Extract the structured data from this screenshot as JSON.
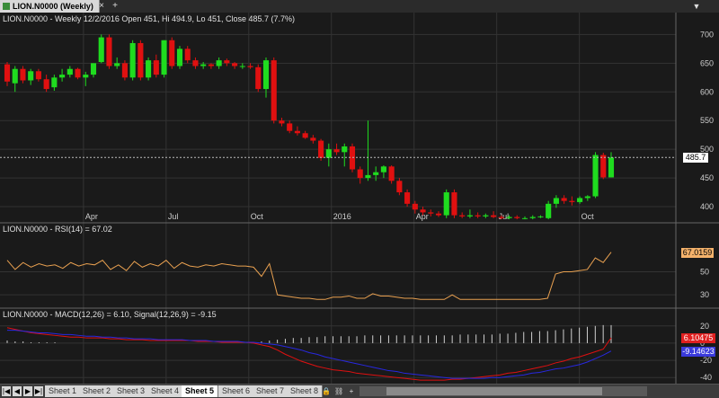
{
  "window": {
    "tab_title": "LION.N0000 (Weekly)",
    "close_glyph": "×",
    "add_glyph": "+",
    "dropdown_glyph": "▼",
    "icons": {
      "doc": "chart-doc-icon",
      "close": "close-icon",
      "add": "add-tab-icon",
      "dropdown": "chevron-down-icon"
    }
  },
  "sheets": {
    "nav": [
      "|◀",
      "◀",
      "▶",
      "▶|"
    ],
    "tabs": [
      "Sheet 1",
      "Sheet 2",
      "Sheet 3",
      "Sheet 4",
      "Sheet 5",
      "Sheet 6",
      "Sheet 7",
      "Sheet 8"
    ],
    "active": "Sheet 5",
    "icons": [
      "lock-icon",
      "link-icon",
      "add-icon"
    ]
  },
  "colors": {
    "bg": "#1a1a1a",
    "up": "#1fdc1f",
    "down": "#e01010",
    "rsi": "#e8a050",
    "macd": "#e01010",
    "signal": "#2828e0",
    "grid": "#333333",
    "last_price_line": "#bbbbbb",
    "price_box": "#ffffff",
    "rsi_box": "#f5b26b",
    "macd_box": "#e02020",
    "signal_box": "#3a3adc"
  },
  "chart_data": [
    {
      "type": "candlestick",
      "title": "LION.N0000 - Weekly 12/2/2016 Open 451, Hi 494.9, Lo 451, Close 485.7 (7.7%)",
      "x_tick_labels": [
        "Apr",
        "Jul",
        "Oct",
        "2016",
        "Apr",
        "Jul",
        "Oct"
      ],
      "y_ticks": [
        400,
        450,
        500,
        550,
        600,
        650,
        700
      ],
      "ylim": [
        375,
        710
      ],
      "last_value": 485.7,
      "last_label": "485.7",
      "candles": [
        {
          "o": 648,
          "h": 652,
          "l": 610,
          "c": 618
        },
        {
          "o": 615,
          "h": 645,
          "l": 600,
          "c": 640
        },
        {
          "o": 640,
          "h": 645,
          "l": 615,
          "c": 620
        },
        {
          "o": 620,
          "h": 640,
          "l": 612,
          "c": 636
        },
        {
          "o": 636,
          "h": 640,
          "l": 618,
          "c": 622
        },
        {
          "o": 622,
          "h": 630,
          "l": 600,
          "c": 605
        },
        {
          "o": 608,
          "h": 630,
          "l": 602,
          "c": 625
        },
        {
          "o": 625,
          "h": 640,
          "l": 618,
          "c": 630
        },
        {
          "o": 630,
          "h": 645,
          "l": 625,
          "c": 640
        },
        {
          "o": 640,
          "h": 642,
          "l": 622,
          "c": 625
        },
        {
          "o": 625,
          "h": 635,
          "l": 610,
          "c": 630
        },
        {
          "o": 630,
          "h": 650,
          "l": 625,
          "c": 650
        },
        {
          "o": 652,
          "h": 700,
          "l": 650,
          "c": 695
        },
        {
          "o": 695,
          "h": 700,
          "l": 640,
          "c": 645
        },
        {
          "o": 645,
          "h": 660,
          "l": 640,
          "c": 650
        },
        {
          "o": 650,
          "h": 655,
          "l": 620,
          "c": 625
        },
        {
          "o": 625,
          "h": 690,
          "l": 620,
          "c": 685
        },
        {
          "o": 685,
          "h": 690,
          "l": 620,
          "c": 625
        },
        {
          "o": 625,
          "h": 660,
          "l": 620,
          "c": 655
        },
        {
          "o": 655,
          "h": 665,
          "l": 625,
          "c": 630
        },
        {
          "o": 630,
          "h": 690,
          "l": 625,
          "c": 690
        },
        {
          "o": 690,
          "h": 695,
          "l": 640,
          "c": 645
        },
        {
          "o": 645,
          "h": 680,
          "l": 640,
          "c": 675
        },
        {
          "o": 675,
          "h": 680,
          "l": 650,
          "c": 655
        },
        {
          "o": 655,
          "h": 660,
          "l": 640,
          "c": 645
        },
        {
          "o": 645,
          "h": 652,
          "l": 640,
          "c": 648
        },
        {
          "o": 648,
          "h": 650,
          "l": 640,
          "c": 645
        },
        {
          "o": 645,
          "h": 660,
          "l": 640,
          "c": 655
        },
        {
          "o": 655,
          "h": 658,
          "l": 645,
          "c": 650
        },
        {
          "o": 650,
          "h": 652,
          "l": 640,
          "c": 645
        },
        {
          "o": 645,
          "h": 650,
          "l": 640,
          "c": 645
        },
        {
          "o": 645,
          "h": 650,
          "l": 640,
          "c": 643
        },
        {
          "o": 643,
          "h": 648,
          "l": 600,
          "c": 605
        },
        {
          "o": 605,
          "h": 660,
          "l": 590,
          "c": 655
        },
        {
          "o": 655,
          "h": 660,
          "l": 545,
          "c": 550
        },
        {
          "o": 550,
          "h": 555,
          "l": 540,
          "c": 545
        },
        {
          "o": 545,
          "h": 550,
          "l": 528,
          "c": 532
        },
        {
          "o": 532,
          "h": 540,
          "l": 524,
          "c": 528
        },
        {
          "o": 528,
          "h": 532,
          "l": 518,
          "c": 520
        },
        {
          "o": 520,
          "h": 525,
          "l": 510,
          "c": 515
        },
        {
          "o": 515,
          "h": 518,
          "l": 480,
          "c": 485
        },
        {
          "o": 485,
          "h": 510,
          "l": 470,
          "c": 500
        },
        {
          "o": 500,
          "h": 510,
          "l": 490,
          "c": 495
        },
        {
          "o": 495,
          "h": 510,
          "l": 470,
          "c": 505
        },
        {
          "o": 505,
          "h": 510,
          "l": 460,
          "c": 465
        },
        {
          "o": 465,
          "h": 470,
          "l": 440,
          "c": 450
        },
        {
          "o": 450,
          "h": 550,
          "l": 445,
          "c": 455
        },
        {
          "o": 455,
          "h": 470,
          "l": 445,
          "c": 460
        },
        {
          "o": 460,
          "h": 472,
          "l": 450,
          "c": 470
        },
        {
          "o": 470,
          "h": 472,
          "l": 440,
          "c": 445
        },
        {
          "o": 445,
          "h": 450,
          "l": 420,
          "c": 425
        },
        {
          "o": 425,
          "h": 430,
          "l": 400,
          "c": 405
        },
        {
          "o": 405,
          "h": 410,
          "l": 388,
          "c": 395
        },
        {
          "o": 395,
          "h": 400,
          "l": 385,
          "c": 390
        },
        {
          "o": 390,
          "h": 395,
          "l": 383,
          "c": 388
        },
        {
          "o": 388,
          "h": 392,
          "l": 382,
          "c": 385
        },
        {
          "o": 385,
          "h": 430,
          "l": 380,
          "c": 425
        },
        {
          "o": 425,
          "h": 430,
          "l": 380,
          "c": 385
        },
        {
          "o": 385,
          "h": 390,
          "l": 380,
          "c": 383
        },
        {
          "o": 383,
          "h": 395,
          "l": 380,
          "c": 385
        },
        {
          "o": 385,
          "h": 390,
          "l": 380,
          "c": 383
        },
        {
          "o": 383,
          "h": 388,
          "l": 380,
          "c": 385
        },
        {
          "o": 385,
          "h": 392,
          "l": 380,
          "c": 382
        },
        {
          "o": 382,
          "h": 385,
          "l": 378,
          "c": 380
        },
        {
          "o": 380,
          "h": 385,
          "l": 378,
          "c": 382
        },
        {
          "o": 382,
          "h": 385,
          "l": 378,
          "c": 380
        },
        {
          "o": 380,
          "h": 383,
          "l": 378,
          "c": 380
        },
        {
          "o": 380,
          "h": 385,
          "l": 378,
          "c": 382
        },
        {
          "o": 382,
          "h": 385,
          "l": 380,
          "c": 383
        },
        {
          "o": 380,
          "h": 410,
          "l": 378,
          "c": 405
        },
        {
          "o": 405,
          "h": 420,
          "l": 398,
          "c": 415
        },
        {
          "o": 415,
          "h": 420,
          "l": 405,
          "c": 410
        },
        {
          "o": 410,
          "h": 418,
          "l": 402,
          "c": 408
        },
        {
          "o": 408,
          "h": 418,
          "l": 405,
          "c": 415
        },
        {
          "o": 415,
          "h": 420,
          "l": 410,
          "c": 418
        },
        {
          "o": 418,
          "h": 495,
          "l": 415,
          "c": 490
        },
        {
          "o": 490,
          "h": 494,
          "l": 448,
          "c": 451
        },
        {
          "o": 451,
          "h": 494.9,
          "l": 451,
          "c": 485.7
        }
      ]
    },
    {
      "type": "line",
      "label": "LION.N0000 - RSI(14) = 67.02",
      "y_ticks": [
        30,
        50
      ],
      "ylim": [
        20,
        80
      ],
      "last_value": 67.0159,
      "last_label": "67.0159",
      "values": [
        60,
        52,
        58,
        54,
        57,
        55,
        56,
        53,
        58,
        55,
        57,
        56,
        60,
        52,
        56,
        51,
        59,
        54,
        57,
        55,
        60,
        53,
        58,
        55,
        54,
        56,
        55,
        57,
        56,
        55,
        55,
        54,
        46,
        57,
        30,
        29,
        28,
        27,
        27,
        26,
        26,
        28,
        28,
        29,
        27,
        27,
        31,
        29,
        29,
        28,
        27,
        27,
        26,
        26,
        26,
        26,
        30,
        26,
        26,
        26,
        26,
        26,
        26,
        26,
        26,
        26,
        26,
        26,
        27,
        48,
        50,
        50,
        51,
        52,
        62,
        58,
        67.02
      ]
    },
    {
      "type": "line",
      "label": "LION.N0000 - MACD(12,26) = 6.10, Signal(12,26,9) = -9.15",
      "y_ticks": [
        -40,
        -20,
        0,
        20
      ],
      "ylim": [
        -45,
        25
      ],
      "macd_last_label": "6.10475",
      "signal_last_label": "-9.14623",
      "series": [
        {
          "name": "MACD(12,26)",
          "values": [
            18,
            16,
            14,
            12,
            11,
            10,
            9,
            8,
            7,
            7,
            6,
            6,
            6,
            5,
            5,
            4,
            4,
            4,
            3,
            3,
            3,
            3,
            3,
            3,
            2,
            2,
            2,
            1,
            1,
            1,
            1,
            0,
            -2,
            -4,
            -8,
            -13,
            -17,
            -21,
            -24,
            -27,
            -29,
            -31,
            -32,
            -33,
            -35,
            -36,
            -37,
            -38,
            -39,
            -40,
            -41,
            -42,
            -43,
            -43,
            -43,
            -43,
            -42,
            -42,
            -41,
            -40,
            -39,
            -38,
            -37,
            -35,
            -34,
            -32,
            -30,
            -28,
            -26,
            -23,
            -21,
            -18,
            -16,
            -13,
            -10,
            -7,
            6.1
          ]
        },
        {
          "name": "Signal(12,26,9)",
          "values": [
            15,
            15,
            14,
            13,
            12,
            12,
            11,
            10,
            10,
            9,
            8,
            8,
            7,
            7,
            6,
            6,
            5,
            5,
            5,
            4,
            4,
            4,
            4,
            3,
            3,
            3,
            2,
            2,
            2,
            2,
            1,
            1,
            0,
            -1,
            -2,
            -4,
            -6,
            -8,
            -11,
            -13,
            -16,
            -18,
            -20,
            -22,
            -24,
            -26,
            -28,
            -30,
            -32,
            -33,
            -35,
            -36,
            -37,
            -38,
            -39,
            -40,
            -41,
            -41,
            -41,
            -41,
            -41,
            -40,
            -40,
            -39,
            -38,
            -37,
            -35,
            -34,
            -32,
            -30,
            -29,
            -27,
            -25,
            -22,
            -18,
            -14,
            -9.15
          ]
        }
      ],
      "histogram": [
        3,
        2,
        2,
        1,
        1,
        1,
        1,
        0,
        0,
        0,
        0,
        0,
        0,
        0,
        0,
        0,
        0,
        0,
        0,
        0,
        0,
        0,
        0,
        0,
        0,
        0,
        0,
        0,
        0,
        0,
        0,
        0,
        2,
        3,
        4,
        5,
        6,
        6,
        7,
        7,
        8,
        8,
        8,
        8,
        8,
        9,
        9,
        9,
        9,
        9,
        9,
        9,
        9,
        9,
        9,
        9,
        9,
        10,
        10,
        10,
        10,
        10,
        11,
        11,
        12,
        13,
        13,
        14,
        14,
        15,
        16,
        17,
        18,
        19,
        20,
        21,
        21
      ]
    }
  ]
}
